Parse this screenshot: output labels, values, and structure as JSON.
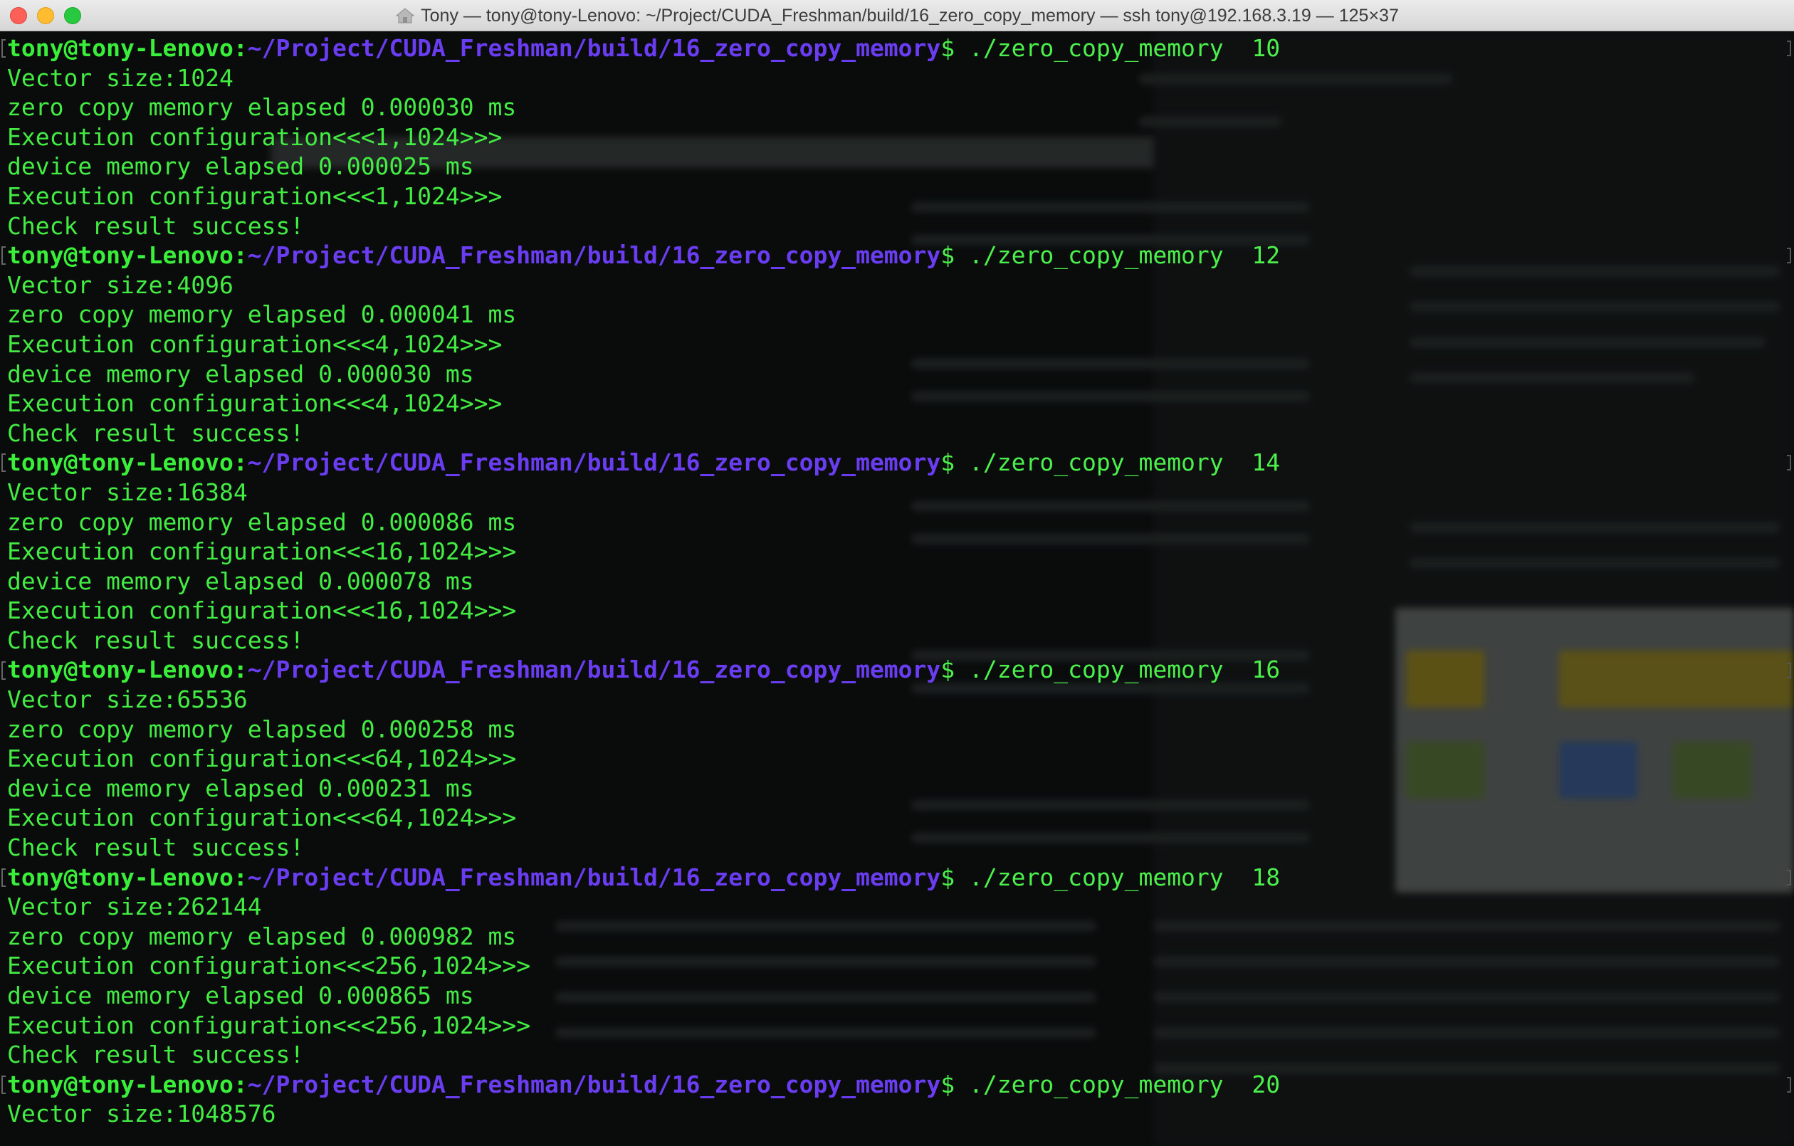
{
  "window": {
    "title": "Tony — tony@tony-Lenovo: ~/Project/CUDA_Freshman/build/16_zero_copy_memory — ssh tony@192.168.3.19 — 125×37",
    "colors": {
      "background": "#0a0c0c",
      "output_text": "#43ec43",
      "prompt_user": "#39ef39",
      "prompt_path": "#6a3df2"
    }
  },
  "terminal": {
    "prompt_user": "tony@tony-Lenovo:",
    "prompt_path": "~/Project/CUDA_Freshman/build/16_zero_copy_memory",
    "prompt_symbol": "$ ",
    "runs": [
      {
        "command": "./zero_copy_memory  10",
        "output": [
          "Vector size:1024",
          "zero copy memory elapsed 0.000030 ms",
          "Execution configuration<<<1,1024>>>",
          "device memory elapsed 0.000025 ms",
          "Execution configuration<<<1,1024>>>",
          "Check result success!"
        ]
      },
      {
        "command": "./zero_copy_memory  12",
        "output": [
          "Vector size:4096",
          "zero copy memory elapsed 0.000041 ms",
          "Execution configuration<<<4,1024>>>",
          "device memory elapsed 0.000030 ms",
          "Execution configuration<<<4,1024>>>",
          "Check result success!"
        ]
      },
      {
        "command": "./zero_copy_memory  14",
        "output": [
          "Vector size:16384",
          "zero copy memory elapsed 0.000086 ms",
          "Execution configuration<<<16,1024>>>",
          "device memory elapsed 0.000078 ms",
          "Execution configuration<<<16,1024>>>",
          "Check result success!"
        ]
      },
      {
        "command": "./zero_copy_memory  16",
        "output": [
          "Vector size:65536",
          "zero copy memory elapsed 0.000258 ms",
          "Execution configuration<<<64,1024>>>",
          "device memory elapsed 0.000231 ms",
          "Execution configuration<<<64,1024>>>",
          "Check result success!"
        ]
      },
      {
        "command": "./zero_copy_memory  18",
        "output": [
          "Vector size:262144",
          "zero copy memory elapsed 0.000982 ms",
          "Execution configuration<<<256,1024>>>",
          "device memory elapsed 0.000865 ms",
          "Execution configuration<<<256,1024>>>",
          "Check result success!"
        ]
      },
      {
        "command": "./zero_copy_memory  20",
        "output": [
          "Vector size:1048576"
        ]
      }
    ]
  }
}
